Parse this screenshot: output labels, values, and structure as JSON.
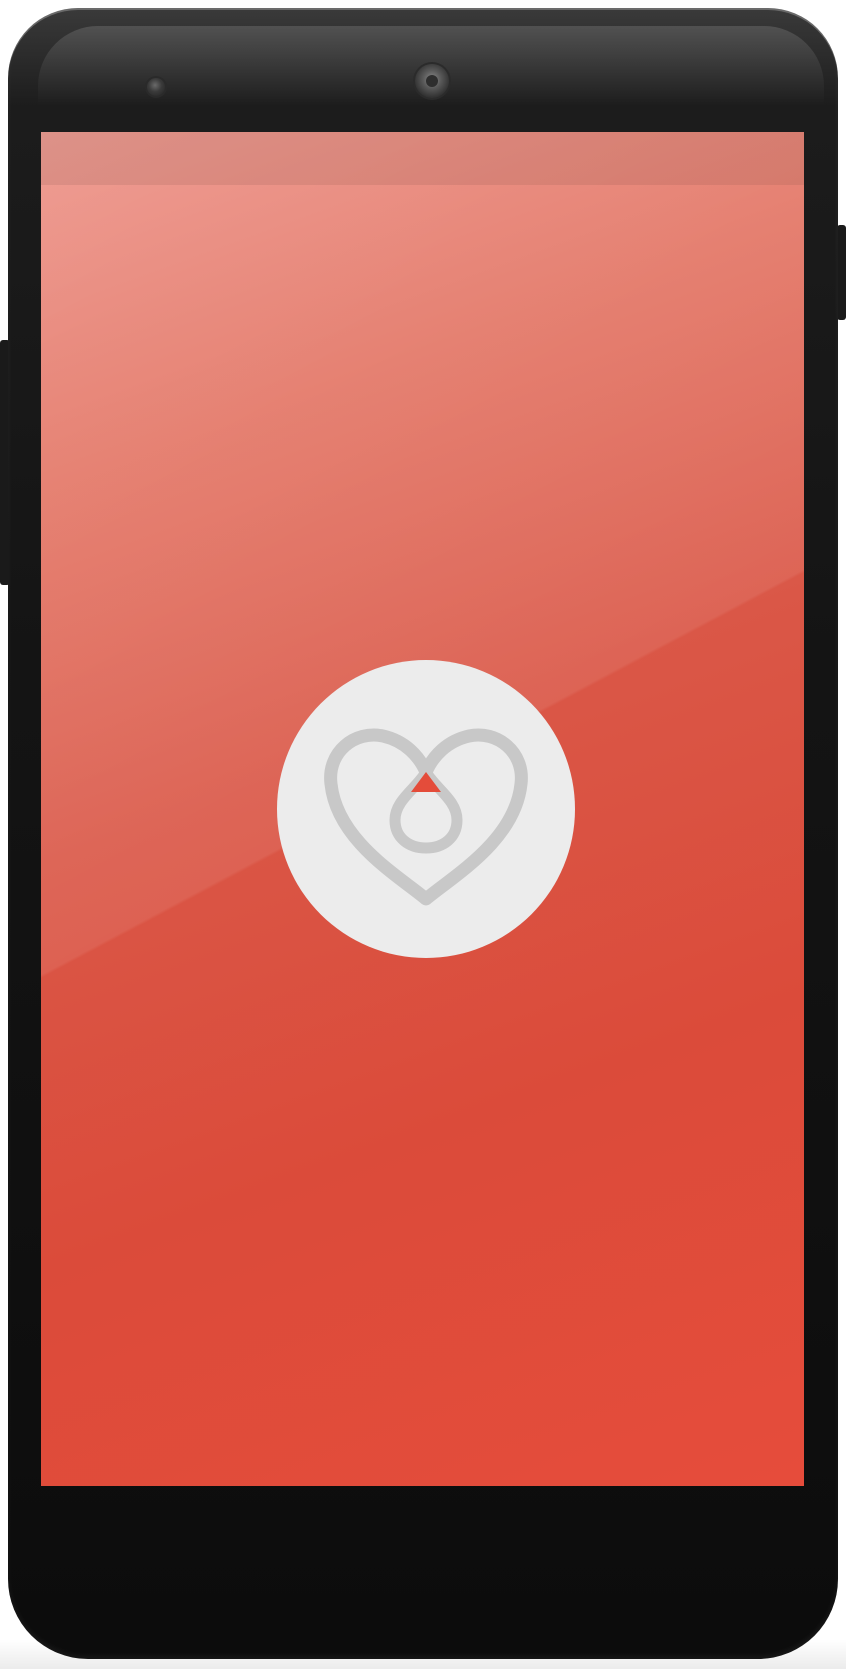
{
  "device": {
    "model_icon": "phone-device",
    "body_color": "#141414"
  },
  "screen": {
    "background_top": "#ec8b80",
    "background_bottom": "#e64c3b",
    "status_bar_color": "#c9675a"
  },
  "splash": {
    "logo_icon": "heart-drop-icon",
    "logo_circle_color": "#ececec",
    "logo_stroke_color": "#c8c8c8",
    "logo_accent_color": "#e44c3a"
  }
}
